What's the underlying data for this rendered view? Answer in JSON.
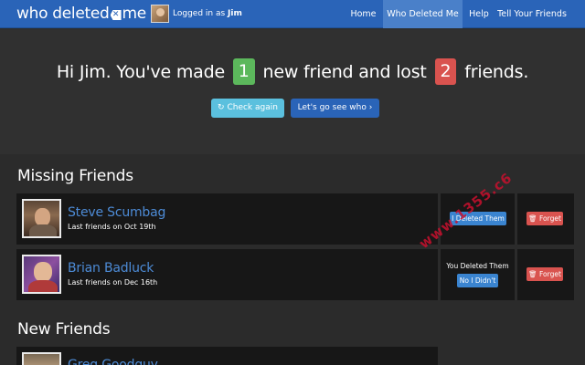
{
  "navbar": {
    "brand_prefix": "who deleted",
    "brand_suffix": "me",
    "logged_in_prefix": "Logged in as",
    "user_name": "Jim",
    "links": [
      {
        "label": "Home",
        "active": false
      },
      {
        "label": "Who Deleted Me",
        "active": true
      },
      {
        "label": "Help",
        "active": false
      },
      {
        "label": "Tell Your Friends",
        "active": false
      }
    ]
  },
  "hero": {
    "greeting": "Hi Jim. You've made",
    "new_count": "1",
    "middle": "new friend and lost",
    "lost_count": "2",
    "suffix": "friends.",
    "check_again_label": "Check again",
    "see_who_label": "Let's go see who"
  },
  "missing": {
    "title": "Missing Friends",
    "rows": [
      {
        "name": "Steve Scumbag",
        "since": "Last friends on Oct 19th",
        "action_label": "I Deleted Them",
        "forget_label": "Forget"
      },
      {
        "name": "Brian Badluck",
        "since": "Last friends on Dec 16th",
        "status_text": "You Deleted Them",
        "action_label": "No I Didn't",
        "forget_label": "Forget"
      }
    ]
  },
  "new_friends": {
    "title": "New Friends",
    "rows": [
      {
        "name": "Greg Goodguy"
      }
    ]
  },
  "watermark": "www.1355.c6",
  "colors": {
    "nav_bg": "#2a64b8",
    "green_badge": "#5cb85c",
    "red_badge": "#d9534f",
    "link_blue": "#4d8bd6"
  }
}
